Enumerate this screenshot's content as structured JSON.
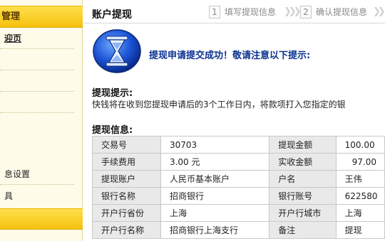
{
  "sidebar": {
    "header": "管理",
    "items": [
      {
        "label": "迎页",
        "active": true
      },
      {
        "label": ""
      },
      {
        "label": ""
      },
      {
        "label": ""
      },
      {
        "label": ""
      },
      {
        "label": "息设置"
      },
      {
        "label": "具"
      }
    ],
    "footer": "​"
  },
  "page": {
    "title": "账户提现",
    "steps": [
      {
        "num": "1",
        "label": "填写提现信息"
      },
      {
        "num": "2",
        "label": "确认提现信息"
      }
    ]
  },
  "success": {
    "icon": "hourglass-icon",
    "message": "提现申请提交成功！敬请注意以下提示:"
  },
  "tips": {
    "title": "提现提示:",
    "text": "快钱将在收到您提现申请后的3个工作日内，将款项打入您指定的银"
  },
  "info": {
    "title": "提现信息:",
    "rows": [
      [
        "交易号",
        "30703",
        "提现金额",
        "100.00"
      ],
      [
        "手续费用",
        "3.00 元",
        "实收金额",
        "97.00"
      ],
      [
        "提现账户",
        "人民币基本账户",
        "户名",
        "王伟"
      ],
      [
        "银行名称",
        "招商银行",
        "银行账号",
        "622580"
      ],
      [
        "开户行省份",
        "上海",
        "开户行城市",
        "上海"
      ],
      [
        "开户行名称",
        "招商银行上海支行",
        "备注",
        "提现"
      ]
    ]
  },
  "colors": {
    "sidebar_bg": "#fffbe9",
    "sidebar_accent": "#f6c10f",
    "success_text": "#0a3190",
    "table_label_bg": "#e9e9e9"
  }
}
